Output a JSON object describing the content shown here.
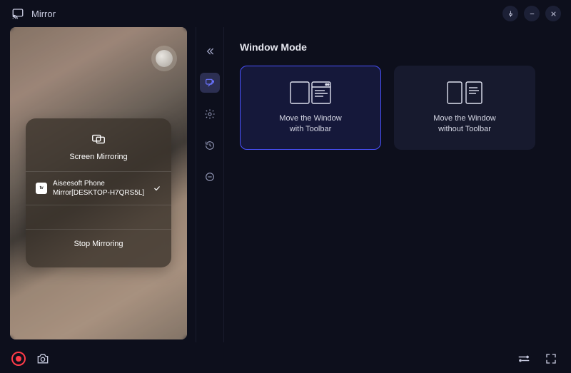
{
  "app": {
    "title": "Mirror"
  },
  "preview": {
    "card_title": "Screen Mirroring",
    "device_name": "Aiseesoft Phone Mirror[DESKTOP-H7QRS5L]",
    "device_badge": "tv",
    "stop_label": "Stop Mirroring"
  },
  "sidebar": {
    "icons": [
      "collapse",
      "window-mode",
      "settings",
      "history",
      "power"
    ]
  },
  "main": {
    "title": "Window Mode",
    "cards": [
      {
        "label_line1": "Move the Window",
        "label_line2": "with Toolbar",
        "selected": true
      },
      {
        "label_line1": "Move the Window",
        "label_line2": "without Toolbar",
        "selected": false
      }
    ]
  }
}
